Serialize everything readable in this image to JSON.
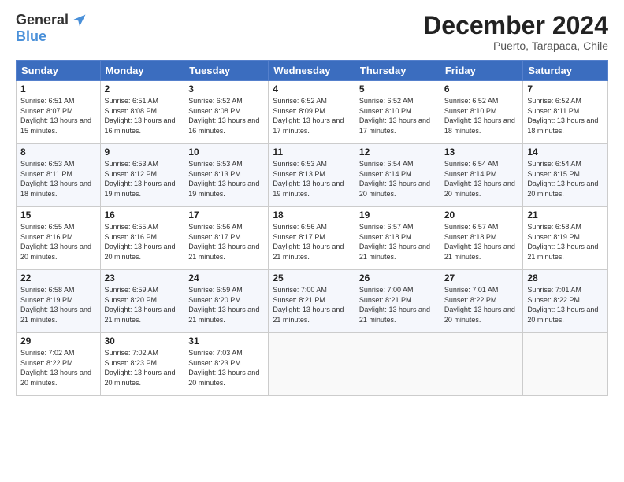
{
  "logo": {
    "general": "General",
    "blue": "Blue"
  },
  "title": "December 2024",
  "location": "Puerto, Tarapaca, Chile",
  "weekdays": [
    "Sunday",
    "Monday",
    "Tuesday",
    "Wednesday",
    "Thursday",
    "Friday",
    "Saturday"
  ],
  "weeks": [
    [
      {
        "day": "1",
        "info": "Sunrise: 6:51 AM\nSunset: 8:07 PM\nDaylight: 13 hours\nand 15 minutes."
      },
      {
        "day": "2",
        "info": "Sunrise: 6:51 AM\nSunset: 8:08 PM\nDaylight: 13 hours\nand 16 minutes."
      },
      {
        "day": "3",
        "info": "Sunrise: 6:52 AM\nSunset: 8:08 PM\nDaylight: 13 hours\nand 16 minutes."
      },
      {
        "day": "4",
        "info": "Sunrise: 6:52 AM\nSunset: 8:09 PM\nDaylight: 13 hours\nand 17 minutes."
      },
      {
        "day": "5",
        "info": "Sunrise: 6:52 AM\nSunset: 8:10 PM\nDaylight: 13 hours\nand 17 minutes."
      },
      {
        "day": "6",
        "info": "Sunrise: 6:52 AM\nSunset: 8:10 PM\nDaylight: 13 hours\nand 18 minutes."
      },
      {
        "day": "7",
        "info": "Sunrise: 6:52 AM\nSunset: 8:11 PM\nDaylight: 13 hours\nand 18 minutes."
      }
    ],
    [
      {
        "day": "8",
        "info": "Sunrise: 6:53 AM\nSunset: 8:11 PM\nDaylight: 13 hours\nand 18 minutes."
      },
      {
        "day": "9",
        "info": "Sunrise: 6:53 AM\nSunset: 8:12 PM\nDaylight: 13 hours\nand 19 minutes."
      },
      {
        "day": "10",
        "info": "Sunrise: 6:53 AM\nSunset: 8:13 PM\nDaylight: 13 hours\nand 19 minutes."
      },
      {
        "day": "11",
        "info": "Sunrise: 6:53 AM\nSunset: 8:13 PM\nDaylight: 13 hours\nand 19 minutes."
      },
      {
        "day": "12",
        "info": "Sunrise: 6:54 AM\nSunset: 8:14 PM\nDaylight: 13 hours\nand 20 minutes."
      },
      {
        "day": "13",
        "info": "Sunrise: 6:54 AM\nSunset: 8:14 PM\nDaylight: 13 hours\nand 20 minutes."
      },
      {
        "day": "14",
        "info": "Sunrise: 6:54 AM\nSunset: 8:15 PM\nDaylight: 13 hours\nand 20 minutes."
      }
    ],
    [
      {
        "day": "15",
        "info": "Sunrise: 6:55 AM\nSunset: 8:16 PM\nDaylight: 13 hours\nand 20 minutes."
      },
      {
        "day": "16",
        "info": "Sunrise: 6:55 AM\nSunset: 8:16 PM\nDaylight: 13 hours\nand 20 minutes."
      },
      {
        "day": "17",
        "info": "Sunrise: 6:56 AM\nSunset: 8:17 PM\nDaylight: 13 hours\nand 21 minutes."
      },
      {
        "day": "18",
        "info": "Sunrise: 6:56 AM\nSunset: 8:17 PM\nDaylight: 13 hours\nand 21 minutes."
      },
      {
        "day": "19",
        "info": "Sunrise: 6:57 AM\nSunset: 8:18 PM\nDaylight: 13 hours\nand 21 minutes."
      },
      {
        "day": "20",
        "info": "Sunrise: 6:57 AM\nSunset: 8:18 PM\nDaylight: 13 hours\nand 21 minutes."
      },
      {
        "day": "21",
        "info": "Sunrise: 6:58 AM\nSunset: 8:19 PM\nDaylight: 13 hours\nand 21 minutes."
      }
    ],
    [
      {
        "day": "22",
        "info": "Sunrise: 6:58 AM\nSunset: 8:19 PM\nDaylight: 13 hours\nand 21 minutes."
      },
      {
        "day": "23",
        "info": "Sunrise: 6:59 AM\nSunset: 8:20 PM\nDaylight: 13 hours\nand 21 minutes."
      },
      {
        "day": "24",
        "info": "Sunrise: 6:59 AM\nSunset: 8:20 PM\nDaylight: 13 hours\nand 21 minutes."
      },
      {
        "day": "25",
        "info": "Sunrise: 7:00 AM\nSunset: 8:21 PM\nDaylight: 13 hours\nand 21 minutes."
      },
      {
        "day": "26",
        "info": "Sunrise: 7:00 AM\nSunset: 8:21 PM\nDaylight: 13 hours\nand 21 minutes."
      },
      {
        "day": "27",
        "info": "Sunrise: 7:01 AM\nSunset: 8:22 PM\nDaylight: 13 hours\nand 20 minutes."
      },
      {
        "day": "28",
        "info": "Sunrise: 7:01 AM\nSunset: 8:22 PM\nDaylight: 13 hours\nand 20 minutes."
      }
    ],
    [
      {
        "day": "29",
        "info": "Sunrise: 7:02 AM\nSunset: 8:22 PM\nDaylight: 13 hours\nand 20 minutes."
      },
      {
        "day": "30",
        "info": "Sunrise: 7:02 AM\nSunset: 8:23 PM\nDaylight: 13 hours\nand 20 minutes."
      },
      {
        "day": "31",
        "info": "Sunrise: 7:03 AM\nSunset: 8:23 PM\nDaylight: 13 hours\nand 20 minutes."
      },
      {
        "day": "",
        "info": ""
      },
      {
        "day": "",
        "info": ""
      },
      {
        "day": "",
        "info": ""
      },
      {
        "day": "",
        "info": ""
      }
    ]
  ]
}
